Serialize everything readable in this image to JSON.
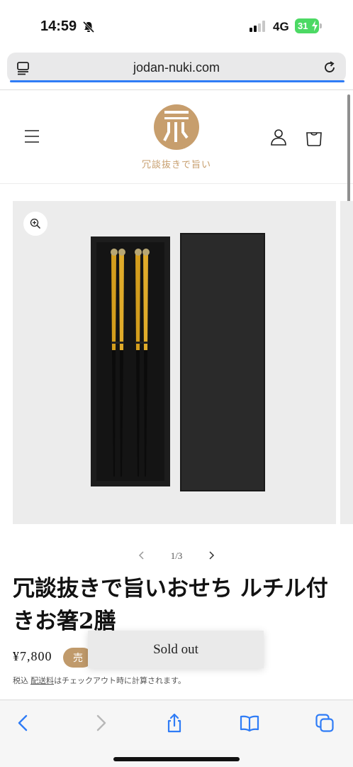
{
  "status_bar": {
    "time": "14:59",
    "network": "4G",
    "battery": "31",
    "icons": [
      "bell-slash-icon",
      "cellular-signal-icon",
      "battery-charging-icon"
    ]
  },
  "browser": {
    "url": "jodan-nuki.com",
    "icons": [
      "tabs-icon",
      "reload-icon"
    ],
    "accent_color": "#2f7cf6"
  },
  "header": {
    "logo_text": "冗談抜きで旨い",
    "brand_color": "#c79e6d",
    "icons": [
      "menu-icon",
      "account-icon",
      "cart-icon"
    ]
  },
  "product": {
    "slider_count": "1/3",
    "title": "冗談抜きで旨いおせち ルチル付きお箸2膳",
    "price": "¥7,800",
    "badge": "売",
    "tax_prefix": "税込 ",
    "shipping_link": "配送料",
    "tax_suffix": "はチェックアウト時に計算されます。",
    "sold_out_label": "Sold out"
  },
  "toolbar": {
    "icons": [
      "back-icon",
      "forward-icon",
      "share-icon",
      "bookmarks-icon",
      "tab-switcher-icon"
    ]
  }
}
